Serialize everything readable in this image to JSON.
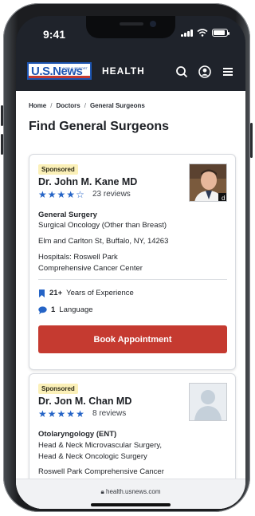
{
  "status": {
    "time": "9:41"
  },
  "header": {
    "logo_text": "U.S.News",
    "logo_sub": "WORLD REPORT",
    "section": "HEALTH",
    "icons": [
      "search-icon",
      "account-icon",
      "menu-icon"
    ]
  },
  "breadcrumb": [
    "Home",
    "Doctors",
    "General Surgeons"
  ],
  "page_title": "Find General Surgeons",
  "doctors": [
    {
      "badge": "Sponsored",
      "name": "Dr. John M. Kane MD",
      "rating": 4,
      "reviews": "23 reviews",
      "specialty": "General Surgery",
      "subspecialty": "Surgical Oncology (Other than Breast)",
      "address": "Elm and Carlton St, Buffalo, NY, 14263",
      "hospitals_line1": "Hospitals: Roswell Park",
      "hospitals_line2": "Comprehensive Cancer Center",
      "experience_value": "21+",
      "experience_label": "Years of Experience",
      "language_value": "1",
      "language_label": "Language",
      "book_label": "Book Appointment"
    },
    {
      "badge": "Sponsored",
      "name": "Dr. Jon M. Chan MD",
      "rating": 5,
      "reviews": "8 reviews",
      "specialty": "Otolaryngology (ENT)",
      "subspecialty_line1": "Head & Neck Microvascular Surgery,",
      "subspecialty_line2": "Head & Neck Oncologic Surgery",
      "hospital": "Roswell Park Comprehensive Cancer"
    }
  ],
  "url": "health.usnews.com",
  "colors": {
    "accent": "#2564c6",
    "button": "#c53a30",
    "header": "#1f232b",
    "badge": "#fbf0b8"
  }
}
